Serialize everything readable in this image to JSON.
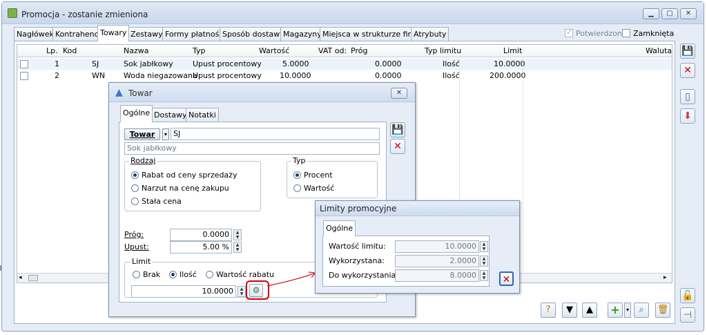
{
  "window": {
    "title": "Promocja - zostanie zmieniona"
  },
  "tabs": [
    "Nagłówek",
    "Kontrahenci",
    "Towary",
    "Zestawy",
    "Formy płatności",
    "Sposób dostawy",
    "Magazyny",
    "Miejsca w strukturze firmy",
    "Atrybuty"
  ],
  "header_checks": {
    "confirmed_label": "Potwierdzona",
    "closed_label": "Zamknięta"
  },
  "columns": {
    "lp": "Lp.",
    "kod": "Kod",
    "nazwa": "Nazwa",
    "typ": "Typ",
    "wartosc": "Wartość",
    "vat": "VAT od:",
    "prog": "Próg",
    "typ_limitu": "Typ limitu",
    "limit": "Limit",
    "waluta": "Waluta"
  },
  "rows": [
    {
      "lp": "1",
      "kod": "SJ",
      "nazwa": "Sok jabłkowy",
      "typ": "Upust procentowy",
      "wartosc": "5.0000",
      "prog": "0.0000",
      "typ_limitu": "Ilość",
      "limit": "10.0000"
    },
    {
      "lp": "2",
      "kod": "WN",
      "nazwa": "Woda niegazowana",
      "typ": "Upust procentowy",
      "wartosc": "10.0000",
      "prog": "0.0000",
      "typ_limitu": "Ilość",
      "limit": "200.0000"
    }
  ],
  "towar": {
    "title": "Towar",
    "tabs": [
      "Ogólne",
      "Dostawy",
      "Notatki"
    ],
    "towar_btn": "Towar",
    "code": "SJ",
    "name": "Sok jabłkowy",
    "rodzaj_label": "Rodzaj",
    "rodzaj_options": [
      "Rabat od ceny sprzedaży",
      "Narzut na cenę zakupu",
      "Stała cena"
    ],
    "typ_label": "Typ",
    "typ_options": [
      "Procent",
      "Wartość"
    ],
    "prog_label": "Próg:",
    "prog_value": "0.0000",
    "upust_label": "Upust:",
    "upust_value": "5.00 %",
    "limit_label": "Limit",
    "limit_options": [
      "Brak",
      "Ilość",
      "Wartość rabatu"
    ],
    "limit_value": "10.0000"
  },
  "limity": {
    "title": "Limity promocyjne",
    "tab": "Ogólne",
    "wartosc_label": "Wartość limitu:",
    "wartosc_value": "10.0000",
    "wykorzystana_label": "Wykorzystana:",
    "wykorzystana_value": "2.0000",
    "do_label": "Do wykorzystania:",
    "do_value": "8.0000"
  },
  "colors": {
    "accent": "#1c3d6b",
    "highlight": "#cc0000"
  }
}
